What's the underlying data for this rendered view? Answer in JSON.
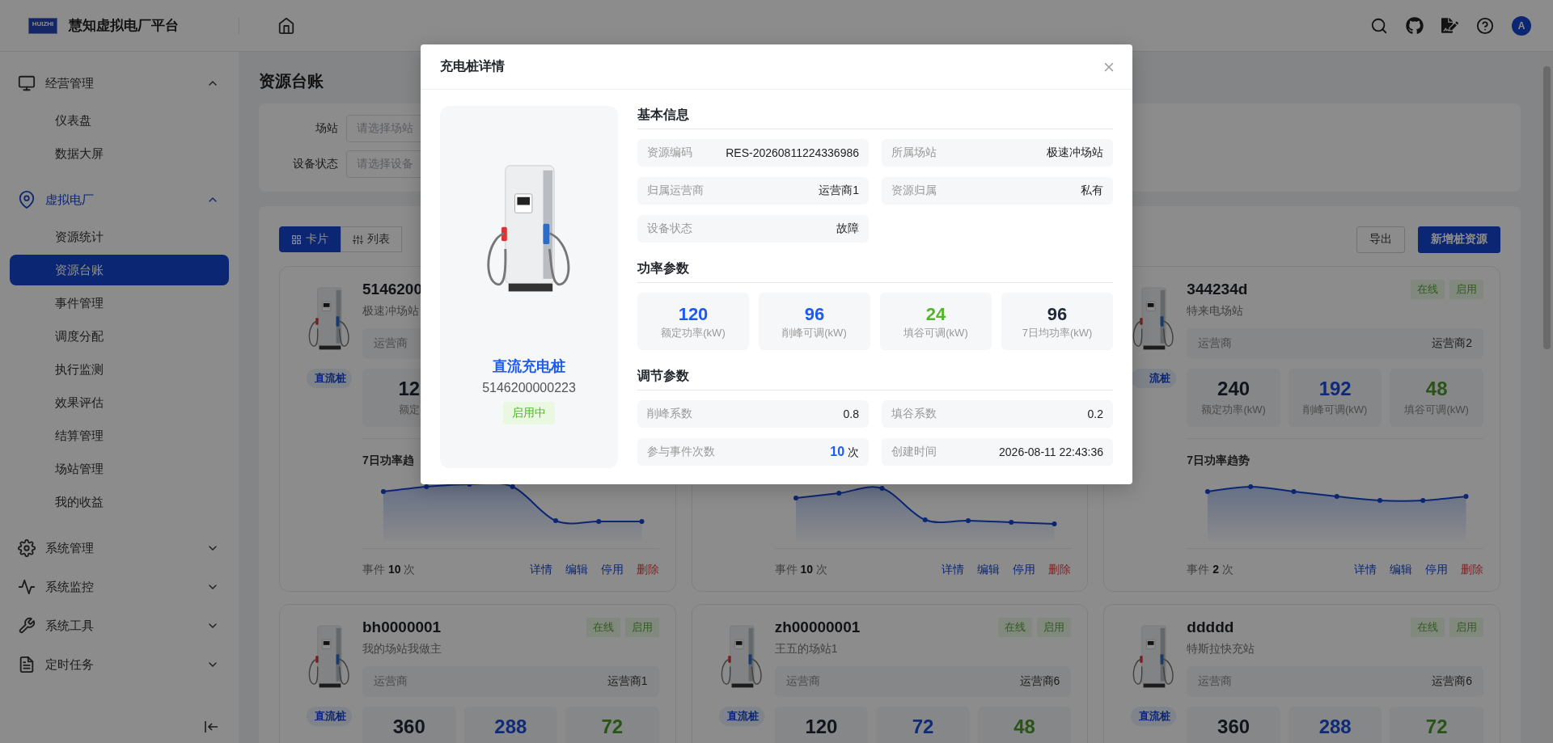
{
  "header": {
    "logo_text": "HUIZHI",
    "title": "慧知虚拟电厂平台",
    "avatar": "A"
  },
  "sidebar": {
    "groups": [
      {
        "label": "经营管理",
        "expanded": true,
        "active": false,
        "children": [
          {
            "label": "仪表盘",
            "selected": false
          },
          {
            "label": "数据大屏",
            "selected": false
          }
        ]
      },
      {
        "label": "虚拟电厂",
        "expanded": true,
        "active": true,
        "children": [
          {
            "label": "资源统计",
            "selected": false
          },
          {
            "label": "资源台账",
            "selected": true
          },
          {
            "label": "事件管理",
            "selected": false
          },
          {
            "label": "调度分配",
            "selected": false
          },
          {
            "label": "执行监测",
            "selected": false
          },
          {
            "label": "效果评估",
            "selected": false
          },
          {
            "label": "结算管理",
            "selected": false
          },
          {
            "label": "场站管理",
            "selected": false
          },
          {
            "label": "我的收益",
            "selected": false
          }
        ]
      },
      {
        "label": "系统管理",
        "expanded": false,
        "active": false
      },
      {
        "label": "系统监控",
        "expanded": false,
        "active": false
      },
      {
        "label": "系统工具",
        "expanded": false,
        "active": false
      },
      {
        "label": "定时任务",
        "expanded": false,
        "active": false
      }
    ]
  },
  "page": {
    "title": "资源台账"
  },
  "filters": [
    {
      "label": "场站",
      "placeholder": "请选择场站"
    },
    {
      "label": "设备状态",
      "placeholder": "请选择设备"
    }
  ],
  "view_toggle": [
    {
      "label": "卡片",
      "selected": true
    },
    {
      "label": "列表",
      "selected": false
    }
  ],
  "actions": [
    {
      "label": "导出",
      "kind": "default"
    },
    {
      "label": "新增桩资源",
      "kind": "primary"
    }
  ],
  "cards": [
    {
      "title": "5146200",
      "station": "极速冲场站",
      "badge": "直流桩",
      "operator_label": "运营商",
      "stats": [
        {
          "value": "12",
          "label": "额定"
        }
      ],
      "trend_title": "7日功率趋",
      "footer": "事件 **10** 次",
      "links": [
        {
          "label": "详情",
          "kind": "normal"
        },
        {
          "label": "编辑",
          "kind": "normal"
        },
        {
          "label": "停用",
          "kind": "normal"
        },
        {
          "label": "删除",
          "kind": "danger"
        }
      ]
    },
    {
      "footer": "事件 **10** 次",
      "links": [
        {
          "label": "详情",
          "kind": "normal"
        },
        {
          "label": "编辑",
          "kind": "normal"
        },
        {
          "label": "停用",
          "kind": "normal"
        },
        {
          "label": "删除",
          "kind": "danger"
        }
      ]
    },
    {
      "title": "344234d",
      "station": "特来电场站",
      "tags": [
        "在线",
        "启用"
      ],
      "badge": "流桩",
      "operator_label": "运营商",
      "operator": "运营商2",
      "stats": [
        {
          "value": "240",
          "label": "额定功率(kW)"
        },
        {
          "value": "192",
          "label": "削峰可调(kW)"
        },
        {
          "value": "48",
          "label": "填谷可调(kW)"
        }
      ],
      "trend_title": "7日功率趋势",
      "footer": "事件 **2** 次",
      "links": [
        {
          "label": "详情",
          "kind": "normal"
        },
        {
          "label": "编辑",
          "kind": "normal"
        },
        {
          "label": "停用",
          "kind": "normal"
        },
        {
          "label": "删除",
          "kind": "danger"
        }
      ]
    },
    {
      "title": "bh0000001",
      "station": "我的场站我做主",
      "tags": [
        "在线",
        "启用"
      ],
      "badge": "直流桩",
      "operator_label": "运营商",
      "operator": "运营商1",
      "stats": [
        {
          "value": "360"
        },
        {
          "value": "288"
        },
        {
          "value": "72"
        }
      ]
    },
    {
      "title": "zh00000001",
      "station": "王五的场站1",
      "tags": [
        "在线",
        "启用"
      ],
      "badge": "直流桩",
      "operator_label": "运营商",
      "operator": "运营商6",
      "stats": [
        {
          "value": "120"
        },
        {
          "value": "72"
        },
        {
          "value": "48"
        }
      ]
    },
    {
      "title": "ddddd",
      "station": "特斯拉快充站",
      "tags": [
        "在线",
        "启用"
      ],
      "badge": "直流桩",
      "operator_label": "运营商",
      "operator": "运营商6",
      "stats": [
        {
          "value": "360"
        },
        {
          "value": "288"
        },
        {
          "value": "72"
        }
      ]
    }
  ],
  "modal": {
    "title": "充电桩详情",
    "name": "直流充电桩",
    "code": "5146200000223",
    "status": "启用中",
    "sections": [
      {
        "title": "基本信息",
        "kind": "info",
        "items": [
          {
            "label": "资源编码",
            "value": "RES-20260811224336986"
          },
          {
            "label": "所属场站",
            "value": "极速冲场站"
          },
          {
            "label": "归属运营商",
            "value": "运营商1"
          },
          {
            "label": "资源归属",
            "value": "私有"
          },
          {
            "label": "设备状态",
            "value": "故障"
          }
        ]
      },
      {
        "title": "功率参数",
        "kind": "stats",
        "items": [
          {
            "value": "120",
            "label": "额定功率(kW)",
            "color": "#1d5bf0"
          },
          {
            "value": "96",
            "label": "削峰可调(kW)",
            "color": "#1d5bf0"
          },
          {
            "value": "24",
            "label": "填谷可调(kW)",
            "color": "#52b52a"
          },
          {
            "value": "96",
            "label": "7日均功率(kW)",
            "color": "#1f2937"
          }
        ]
      },
      {
        "title": "调节参数",
        "kind": "info",
        "items": [
          {
            "label": "削峰系数",
            "value": "0.8"
          },
          {
            "label": "填谷系数",
            "value": "0.2"
          },
          {
            "label": "参与事件次数",
            "value": "**10** 次"
          },
          {
            "label": "创建时间",
            "value": "2026-08-11 22:43:36"
          }
        ]
      }
    ]
  }
}
